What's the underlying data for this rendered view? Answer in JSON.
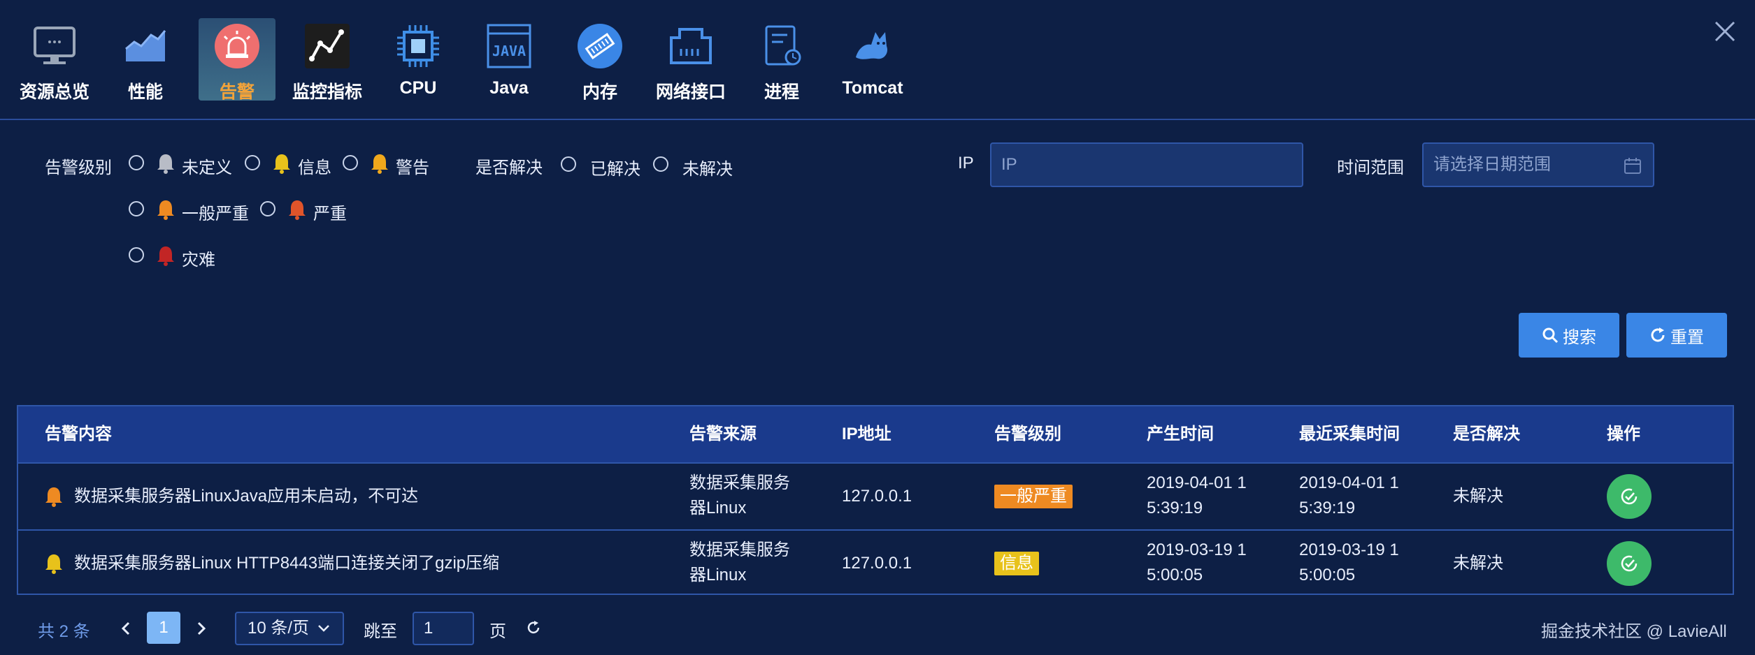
{
  "nav": {
    "items": [
      {
        "label": "资源总览",
        "icon": "monitor-icon"
      },
      {
        "label": "性能",
        "icon": "area-chart-icon"
      },
      {
        "label": "告警",
        "icon": "alarm-icon",
        "active": true
      },
      {
        "label": "监控指标",
        "icon": "line-chart-icon"
      },
      {
        "label": "CPU",
        "icon": "cpu-icon"
      },
      {
        "label": "Java",
        "icon": "java-icon"
      },
      {
        "label": "内存",
        "icon": "memory-icon"
      },
      {
        "label": "网络接口",
        "icon": "network-port-icon"
      },
      {
        "label": "进程",
        "icon": "process-icon"
      },
      {
        "label": "Tomcat",
        "icon": "tomcat-icon"
      }
    ],
    "close_icon": "close-icon"
  },
  "filters": {
    "level_label": "告警级别",
    "levels": [
      {
        "label": "未定义",
        "color": "#b8bcc6"
      },
      {
        "label": "信息",
        "color": "#e8c21b"
      },
      {
        "label": "警告",
        "color": "#f0a81c"
      },
      {
        "label": "一般严重",
        "color": "#ee8a22"
      },
      {
        "label": "严重",
        "color": "#e0542a"
      },
      {
        "label": "灾难",
        "color": "#c22525"
      }
    ],
    "resolved_label": "是否解决",
    "resolved_options": [
      "已解决",
      "未解决"
    ],
    "ip_label": "IP",
    "ip_placeholder": "IP",
    "time_label": "时间范围",
    "time_placeholder": "请选择日期范围"
  },
  "buttons": {
    "search": "搜索",
    "reset": "重置"
  },
  "table": {
    "headers": [
      "告警内容",
      "告警来源",
      "IP地址",
      "告警级别",
      "产生时间",
      "最近采集时间",
      "是否解决",
      "操作"
    ],
    "rows": [
      {
        "content": "数据采集服务器LinuxJava应用未启动，不可达",
        "source_line1": "数据采集服务",
        "source_line2": "器Linux",
        "ip": "127.0.0.1",
        "level": "一般严重",
        "level_color": "#ee8a22",
        "created_line1": "2019-04-01 1",
        "created_line2": "5:39:19",
        "last_line1": "2019-04-01 1",
        "last_line2": "5:39:19",
        "resolved": "未解决"
      },
      {
        "content": "数据采集服务器Linux HTTP8443端口连接关闭了gzip压缩",
        "source_line1": "数据采集服务",
        "source_line2": "器Linux",
        "ip": "127.0.0.1",
        "level": "信息",
        "level_color": "#e8c21b",
        "created_line1": "2019-03-19 1",
        "created_line2": "5:00:05",
        "last_line1": "2019-03-19 1",
        "last_line2": "5:00:05",
        "resolved": "未解决"
      }
    ]
  },
  "pagination": {
    "total": "共 2 条",
    "current_page": "1",
    "page_size": "10 条/页",
    "jump_label": "跳至",
    "jump_value": "1",
    "page_suffix": "页"
  },
  "watermark": "掘金技术社区 @ LavieAll"
}
